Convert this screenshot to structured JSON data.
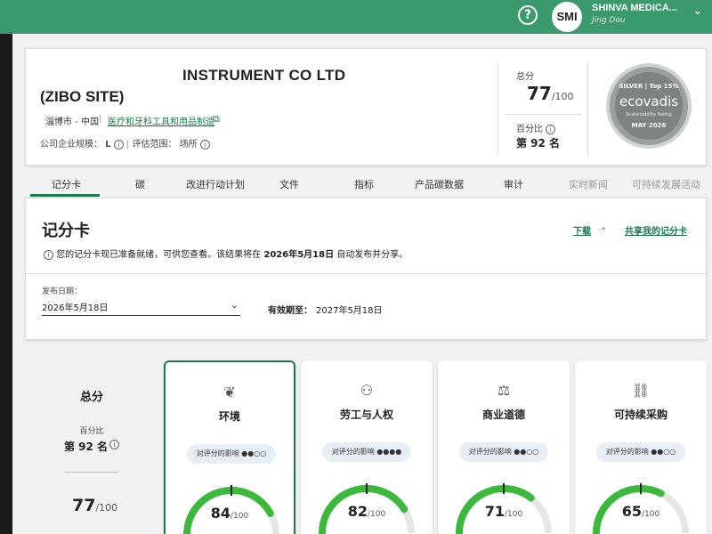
{
  "header": {
    "help_icon": "question-circle-icon",
    "avatar": "SMI",
    "company": "SHINVA MEDICA...",
    "user": "Jing Dou"
  },
  "company": {
    "title": "INSTRUMENT CO LTD",
    "site": "(ZIBO SITE)",
    "location": "淄博市 - 中国",
    "industry": "医疗和牙科工具和用品制造",
    "size_label": "公司企业规模：",
    "size_value": "L",
    "scope_label": "评估范围：",
    "scope_value": "场所"
  },
  "score_box": {
    "total_label": "总分",
    "total_value": "77",
    "total_max": "/100",
    "percentile_label": "百分比",
    "percentile_value": "第 92 名"
  },
  "badge": {
    "top": "SILVER | Top 15%",
    "brand": "ecovadis",
    "sub": "Sustainability Rating",
    "date": "MAY 2026"
  },
  "tabs": [
    {
      "label": "记分卡",
      "active": true
    },
    {
      "label": "碳"
    },
    {
      "label": "改进行动计划"
    },
    {
      "label": "文件"
    },
    {
      "label": "指标"
    },
    {
      "label": "产品碳数据"
    },
    {
      "label": "审计"
    },
    {
      "label": "实时新闻",
      "disabled": true
    },
    {
      "label": "可持续发展活动",
      "disabled": true
    }
  ],
  "scorecard": {
    "title": "记分卡",
    "download": "下载",
    "share": "共享我的记分卡",
    "notice_pre": "您的记分卡现已准备就绪，可供您查看。该结果将在 ",
    "notice_date": "2026年5月18日",
    "notice_post": " 自动发布并分享。",
    "publish_label": "发布日期：",
    "publish_value": "2026年5月18日",
    "valid_label": "有效期至：",
    "valid_value": "2027年5月18日"
  },
  "overall": {
    "title": "总分",
    "pct_label": "百分比",
    "pct_value": "第 92 名",
    "score": "77",
    "max": "/100"
  },
  "themes": [
    {
      "name": "环境",
      "icon": "leaf-icon",
      "impact": "对评分的影响 ●●○○",
      "score": 84,
      "max": "/100"
    },
    {
      "name": "劳工与人权",
      "icon": "people-icon",
      "impact": "对评分的影响 ●●●●",
      "score": 82,
      "max": "/100"
    },
    {
      "name": "商业道德",
      "icon": "scales-icon",
      "impact": "对评分的影响 ●●○○",
      "score": 71,
      "max": "/100"
    },
    {
      "name": "可持续采购",
      "icon": "chain-link-icon",
      "impact": "对评分的影响 ●●○○",
      "score": 65,
      "max": "/100"
    }
  ],
  "colors": {
    "accent": "#1e7a4a",
    "header": "#3a9a6b",
    "gauge": "#3cb93c"
  }
}
